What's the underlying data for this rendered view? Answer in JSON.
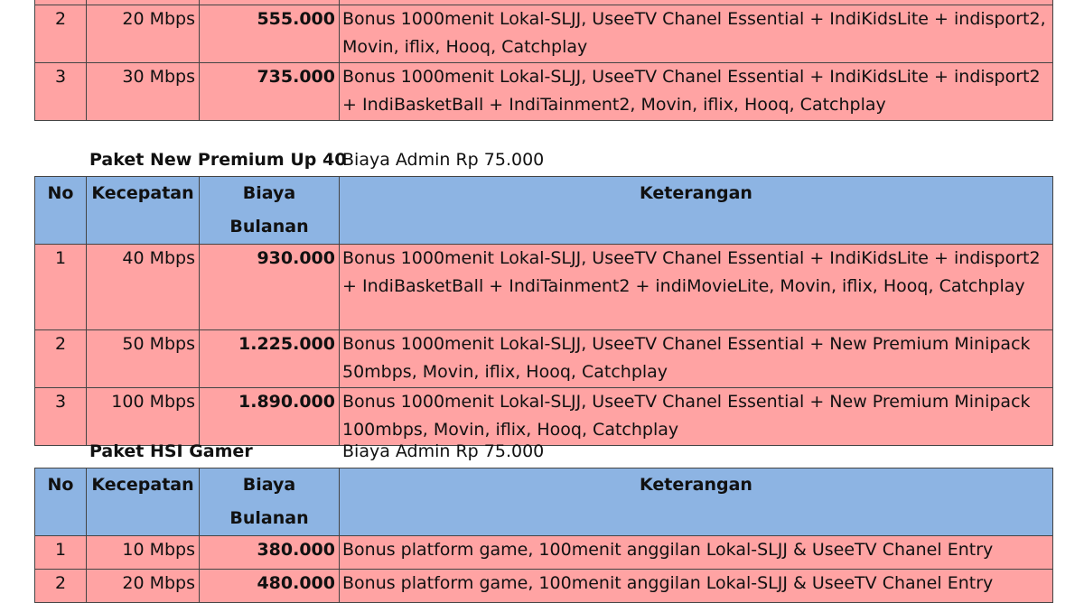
{
  "headers": {
    "no": "No",
    "kecepatan": "Kecepatan",
    "biaya": "Biaya Bulanan",
    "keterangan": "Keterangan"
  },
  "table1": {
    "rows": [
      {
        "no": "2",
        "kecepatan": "20 Mbps",
        "biaya": "555.000",
        "keterangan": "Bonus 1000menit Lokal-SLJJ, UseeTV Chanel Essential + IndiKidsLite + indisport2, Movin, iflix, Hooq, Catchplay"
      },
      {
        "no": "3",
        "kecepatan": "30 Mbps",
        "biaya": "735.000",
        "keterangan": "Bonus 1000menit Lokal-SLJJ, UseeTV Chanel Essential + IndiKidsLite + indisport2 + IndiBasketBall + IndiTainment2, Movin, iflix, Hooq, Catchplay"
      }
    ]
  },
  "package2": {
    "title": "Paket New Premium Up 40",
    "admin": "Biaya Admin Rp 75.000",
    "rows": [
      {
        "no": "1",
        "kecepatan": "40 Mbps",
        "biaya": "930.000",
        "keterangan": "Bonus 1000menit Lokal-SLJJ, UseeTV Chanel Essential + IndiKidsLite + indisport2 + IndiBasketBall + IndiTainment2 + indiMovieLite, Movin, iflix, Hooq, Catchplay"
      },
      {
        "no": "2",
        "kecepatan": "50 Mbps",
        "biaya": "1.225.000",
        "keterangan": "Bonus 1000menit Lokal-SLJJ, UseeTV Chanel Essential + New Premium Minipack 50mbps, Movin, iflix, Hooq, Catchplay"
      },
      {
        "no": "3",
        "kecepatan": "100 Mbps",
        "biaya": "1.890.000",
        "keterangan": "Bonus 1000menit Lokal-SLJJ, UseeTV Chanel Essential + New Premium Minipack 100mbps, Movin, iflix, Hooq, Catchplay"
      }
    ]
  },
  "package3": {
    "title": "Paket HSI Gamer",
    "admin": "Biaya Admin Rp 75.000",
    "rows": [
      {
        "no": "1",
        "kecepatan": "10 Mbps",
        "biaya": "380.000",
        "keterangan": "Bonus platform game, 100menit anggilan Lokal-SLJJ & UseeTV Chanel Entry"
      },
      {
        "no": "2",
        "kecepatan": "20 Mbps",
        "biaya": "480.000",
        "keterangan": "Bonus platform game, 100menit anggilan Lokal-SLJJ & UseeTV Chanel Entry"
      }
    ]
  }
}
